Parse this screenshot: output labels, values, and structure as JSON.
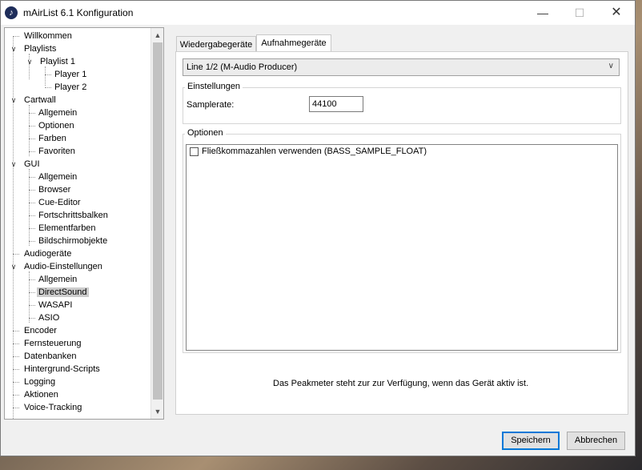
{
  "window": {
    "title": "mAirList 6.1 Konfiguration",
    "app_icon": "mairlist-logo-icon"
  },
  "tree": {
    "items": [
      {
        "label": "Willkommen"
      },
      {
        "label": "Playlists",
        "toggle": "expanded"
      },
      {
        "label": "Playlist 1",
        "toggle": "expanded"
      },
      {
        "label": "Player 1"
      },
      {
        "label": "Player 2"
      },
      {
        "label": "Cartwall",
        "toggle": "expanded"
      },
      {
        "label": "Allgemein"
      },
      {
        "label": "Optionen"
      },
      {
        "label": "Farben"
      },
      {
        "label": "Favoriten"
      },
      {
        "label": "GUI",
        "toggle": "expanded"
      },
      {
        "label": "Allgemein"
      },
      {
        "label": "Browser"
      },
      {
        "label": "Cue-Editor"
      },
      {
        "label": "Fortschrittsbalken"
      },
      {
        "label": "Elementfarben"
      },
      {
        "label": "Bildschirmobjekte"
      },
      {
        "label": "Audiogeräte"
      },
      {
        "label": "Audio-Einstellungen",
        "toggle": "expanded"
      },
      {
        "label": "Allgemein"
      },
      {
        "label": "DirectSound",
        "selected": true
      },
      {
        "label": "WASAPI"
      },
      {
        "label": "ASIO"
      },
      {
        "label": "Encoder"
      },
      {
        "label": "Fernsteuerung"
      },
      {
        "label": "Datenbanken"
      },
      {
        "label": "Hintergrund-Scripts"
      },
      {
        "label": "Logging"
      },
      {
        "label": "Aktionen"
      },
      {
        "label": "Voice-Tracking"
      }
    ]
  },
  "tabs": [
    {
      "label": "Wiedergabegeräte",
      "active": false
    },
    {
      "label": "Aufnahmegeräte",
      "active": true
    }
  ],
  "device_select": {
    "value": "Line 1/2 (M-Audio Producer)"
  },
  "einstellungen": {
    "title": "Einstellungen",
    "samplerate_label": "Samplerate:",
    "samplerate_value": "44100"
  },
  "optionen": {
    "title": "Optionen",
    "items": [
      {
        "label": "Fließkommazahlen verwenden (BASS_SAMPLE_FLOAT)",
        "checked": false
      }
    ]
  },
  "peakmeter_note": "Das Peakmeter steht zur zur Verfügung, wenn das Gerät aktiv ist.",
  "buttons": {
    "save": "Speichern",
    "cancel": "Abbrechen"
  }
}
